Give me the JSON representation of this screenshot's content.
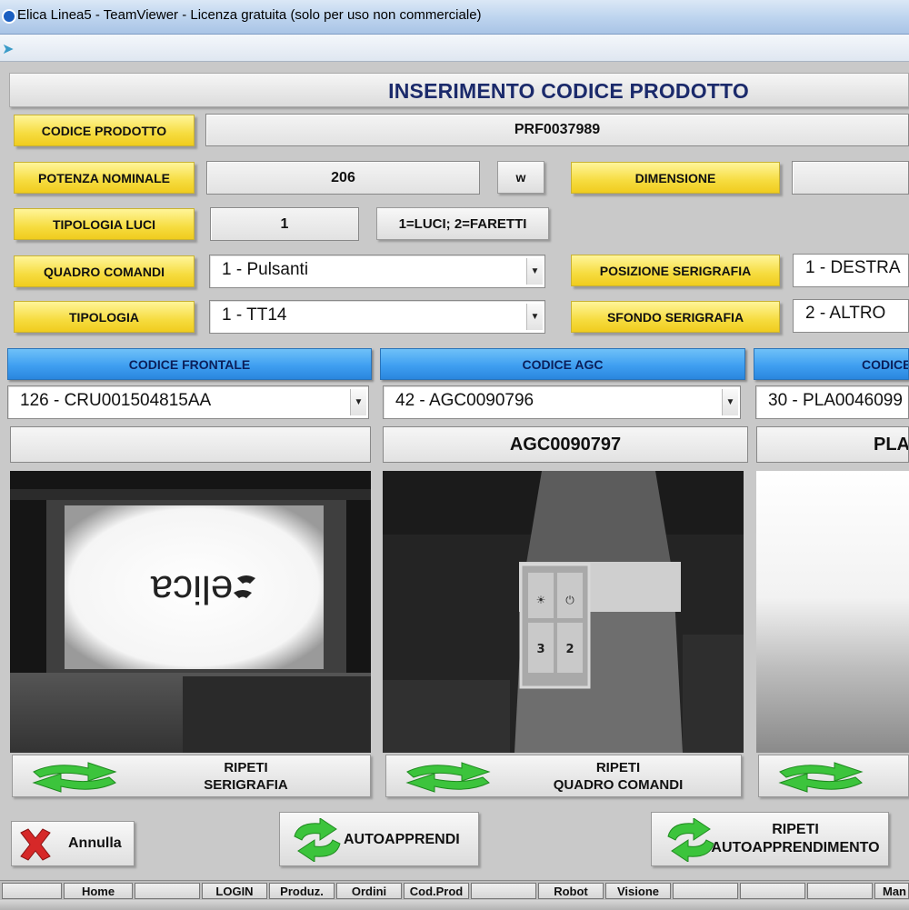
{
  "window": {
    "title": "Elica Linea5 - TeamViewer - Licenza gratuita (solo per uso non commerciale)"
  },
  "form": {
    "heading": "INSERIMENTO CODICE PRODOTTO",
    "codice_prodotto": {
      "label": "CODICE PRODOTTO",
      "value": "PRF0037989"
    },
    "potenza_nominale": {
      "label": "POTENZA NOMINALE",
      "value": "206",
      "unit": "w"
    },
    "dimensione": {
      "label": "DIMENSIONE",
      "value": ""
    },
    "tipologia_luci": {
      "label": "TIPOLOGIA LUCI",
      "value": "1",
      "hint": "1=LUCI; 2=FARETTI"
    },
    "quadro_comandi": {
      "label": "QUADRO COMANDI",
      "value": "1 - Pulsanti"
    },
    "posizione_serigrafia": {
      "label": "POSIZIONE SERIGRAFIA",
      "value": "1 - DESTRA"
    },
    "tipologia": {
      "label": "TIPOLOGIA",
      "value": "1 - TT14"
    },
    "sfondo_serigrafia": {
      "label": "SFONDO SERIGRAFIA",
      "value": "2 - ALTRO"
    }
  },
  "columns": [
    {
      "header": "CODICE FRONTALE",
      "selected": "126 - CRU001504815AA",
      "detected": "",
      "repeat_label_1": "RIPETI",
      "repeat_label_2": "SERIGRAFIA"
    },
    {
      "header": "CODICE AGC",
      "selected": "42 - AGC0090796",
      "detected": "AGC0090797",
      "repeat_label_1": "RIPETI",
      "repeat_label_2": "QUADRO COMANDI"
    },
    {
      "header": "CODICE",
      "selected": "30 - PLA0046099",
      "detected": "PLA",
      "repeat_label_1": "",
      "repeat_label_2": ""
    }
  ],
  "camera": {
    "logo_text": "elica",
    "panel_key_1": "☀",
    "panel_key_2": "⏻",
    "panel_key_3": "3",
    "panel_key_4": "2"
  },
  "actions": {
    "annulla": "Annulla",
    "autoapprendi": "AUTOAPPRENDI",
    "ripeti_auto_1": "RIPETI",
    "ripeti_auto_2": "AUTOAPPRENDIMENTO"
  },
  "footer": {
    "tabs": [
      "",
      "Home",
      "",
      "LOGIN",
      "Produz.",
      "Ordini",
      "Cod.Prod",
      "",
      "Robot",
      "Visione",
      "",
      "",
      "",
      "Man"
    ]
  },
  "colors": {
    "label_yellow": "#f6dc3f",
    "header_blue": "#3f9ff1",
    "heading_text": "#1b2a6b",
    "arrow_green": "#3cc43c",
    "cancel_red": "#d62828"
  },
  "icons": {
    "refresh": "refresh-arrows-icon",
    "cancel": "red-x-icon",
    "dropdown": "chevron-down-icon"
  }
}
